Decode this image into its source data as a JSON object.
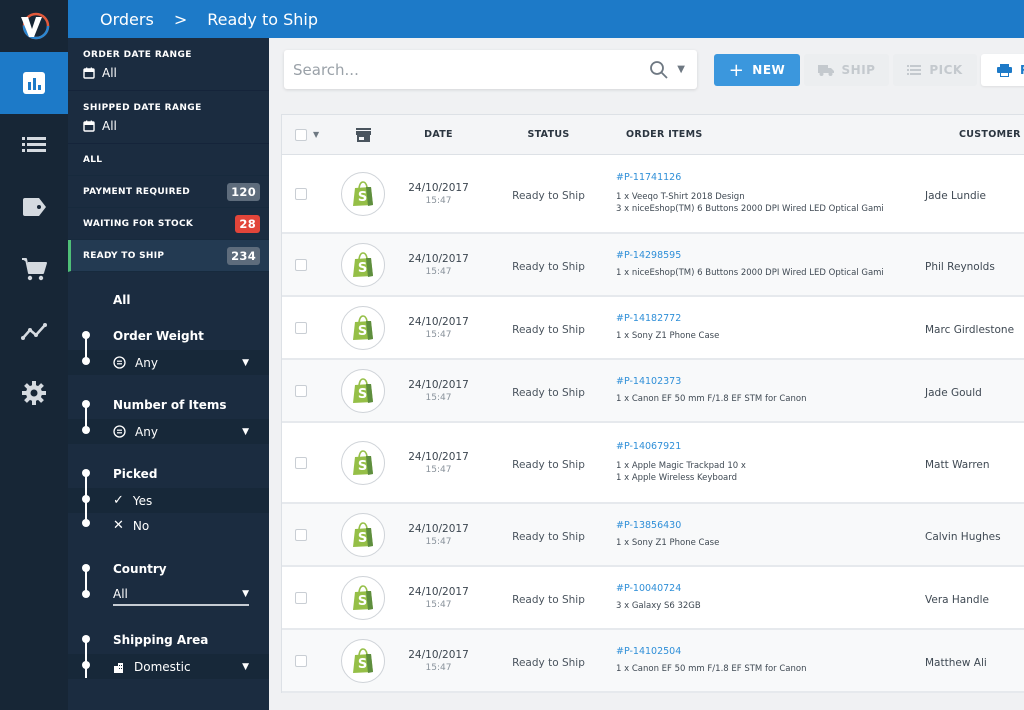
{
  "header": {
    "breadcrumb": [
      "Orders",
      "Ready to Ship"
    ],
    "separator": ">"
  },
  "rail": {
    "items": [
      {
        "icon": "chart-icon",
        "active": true
      },
      {
        "icon": "list-icon"
      },
      {
        "icon": "tag-icon"
      },
      {
        "icon": "cart-icon"
      },
      {
        "icon": "analytics-icon"
      },
      {
        "icon": "gear-icon"
      }
    ]
  },
  "filters": {
    "order_date_range": {
      "label": "ORDER DATE RANGE",
      "value": "All"
    },
    "shipped_date_range": {
      "label": "SHIPPED DATE RANGE",
      "value": "All"
    },
    "statuses": [
      {
        "label": "ALL",
        "count": null
      },
      {
        "label": "PAYMENT REQUIRED",
        "count": "120",
        "color": "#5e6c7c"
      },
      {
        "label": "WAITING FOR STOCK",
        "count": "28",
        "color": "#e2453a"
      },
      {
        "label": "READY TO SHIP",
        "count": "234",
        "color": "#5e6c7c",
        "active": true
      }
    ],
    "all_label": "All",
    "order_weight": {
      "title": "Order Weight",
      "value": "Any"
    },
    "number_of_items": {
      "title": "Number of Items",
      "value": "Any"
    },
    "picked": {
      "title": "Picked",
      "options": [
        "Yes",
        "No"
      ],
      "selected": "Yes"
    },
    "country": {
      "title": "Country",
      "value": "All"
    },
    "shipping_area": {
      "title": "Shipping Area",
      "value": "Domestic"
    }
  },
  "toolbar": {
    "search_placeholder": "Search...",
    "new_label": "NEW",
    "ship_label": "SHIP",
    "pick_label": "PICK",
    "print_label": "P"
  },
  "table": {
    "columns": [
      "DATE",
      "STATUS",
      "ORDER ITEMS",
      "CUSTOMER"
    ],
    "rows": [
      {
        "date": "24/10/2017",
        "time": "15:47",
        "status": "Ready to Ship",
        "order_id": "#P-11741126",
        "items": [
          "1 x Veeqo T-Shirt 2018 Design",
          "3 x niceEshop(TM) 6 Buttons 2000 DPI Wired LED Optical Gami"
        ],
        "customer": "Jade Lundie"
      },
      {
        "date": "24/10/2017",
        "time": "15:47",
        "status": "Ready to Ship",
        "order_id": "#P-14298595",
        "items": [
          "1 x niceEshop(TM) 6 Buttons 2000 DPI Wired LED Optical Gami"
        ],
        "customer": "Phil Reynolds"
      },
      {
        "date": "24/10/2017",
        "time": "15:47",
        "status": "Ready to Ship",
        "order_id": "#P-14182772",
        "items": [
          "1 x Sony Z1 Phone Case"
        ],
        "customer": "Marc Girdlestone"
      },
      {
        "date": "24/10/2017",
        "time": "15:47",
        "status": "Ready to Ship",
        "order_id": "#P-14102373",
        "items": [
          "1 x Canon EF 50 mm F/1.8 EF STM for Canon"
        ],
        "customer": "Jade Gould"
      },
      {
        "date": "24/10/2017",
        "time": "15:47",
        "status": "Ready to Ship",
        "order_id": "#P-14067921",
        "items": [
          "1 x Apple Magic Trackpad 10 x",
          "1 x Apple Wireless Keyboard"
        ],
        "customer": "Matt Warren"
      },
      {
        "date": "24/10/2017",
        "time": "15:47",
        "status": "Ready to Ship",
        "order_id": "#P-13856430",
        "items": [
          "1 x Sony Z1 Phone Case"
        ],
        "customer": "Calvin Hughes"
      },
      {
        "date": "24/10/2017",
        "time": "15:47",
        "status": "Ready to Ship",
        "order_id": "#P-10040724",
        "items": [
          "3 x Galaxy S6 32GB"
        ],
        "customer": "Vera Handle"
      },
      {
        "date": "24/10/2017",
        "time": "15:47",
        "status": "Ready to Ship",
        "order_id": "#P-14102504",
        "items": [
          "1 x Canon EF 50 mm F/1.8 EF STM for Canon"
        ],
        "customer": "Matthew Ali"
      }
    ]
  },
  "colors": {
    "brand_blue": "#1d7ac8",
    "button_blue": "#3b97dd",
    "link_blue": "#2f8fd8",
    "sidebar_dark": "#172636",
    "filter_panel": "#1b2c40",
    "active_green": "#4fbf78",
    "alert_red": "#e2453a",
    "shopify_green": "#95bf47"
  }
}
